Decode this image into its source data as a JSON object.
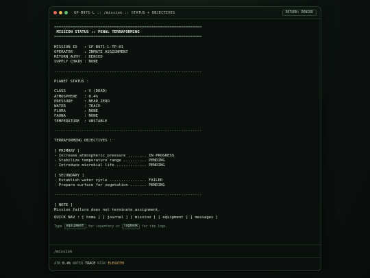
{
  "window": {
    "title": "GP-B971-L :: /mission :: STATUS + OBJECTIVES",
    "badge": "RETURN: DENIED"
  },
  "report": {
    "rule_eq": "================================================================",
    "heading": " MISSION STATUS :: PENAL TERRAFORMING",
    "rule_dash": "----------------------------------------------------------------",
    "mission": [
      "MISSION ID   : GP-B971-L-TP-01",
      "OPERATOR     : INMATE ASSIGNMENT",
      "RETURN AUTH  : DENIED",
      "SUPPLY CHAIN : NONE"
    ],
    "planet_heading": "PLANET STATUS :",
    "planet": [
      "CLASS        : V (DEAD)",
      "ATMOSPHERE   : 0.4%",
      "PRESSURE     : NEAR ZERO",
      "WATER        : TRACE",
      "FLORA        : NONE",
      "FAUNA        : NONE",
      "TEMPERATURE  : UNSTABLE"
    ],
    "objectives_heading": "TERRAFORMING OBJECTIVES :",
    "primary_heading": "[ PRIMARY ]",
    "primary": [
      "- Increase atmospheric pressure ........ IN PROGRESS",
      "- Stabilize temperature range .......... PENDING",
      "- Introduce microbial life ............. PENDING"
    ],
    "secondary_heading": "[ SECONDARY ]",
    "secondary": [
      "- Establish water cycle ................ FAILED",
      "- Prepare surface for vegetation ....... PENDING"
    ],
    "note_heading": "[ NOTE ]",
    "note": "Mission failure does not terminate assignment."
  },
  "nav": {
    "label": "QUICK NAV :",
    "items": [
      "home",
      "journal",
      "mission",
      "equipment",
      "messages"
    ]
  },
  "hint": {
    "prefix": "Type",
    "cmd1": "equipment",
    "mid": "for inventory or",
    "cmd2": "logbook",
    "suffix": "for the logs."
  },
  "prompt": "/mission",
  "statusbar": {
    "atm_label": "ATM",
    "atm_value": "0.4%",
    "water_label": "WATER",
    "water_value": "TRACE",
    "risk_label": "RISK",
    "risk_value": "ELEVATED",
    "risk_color": "#e2a453"
  }
}
